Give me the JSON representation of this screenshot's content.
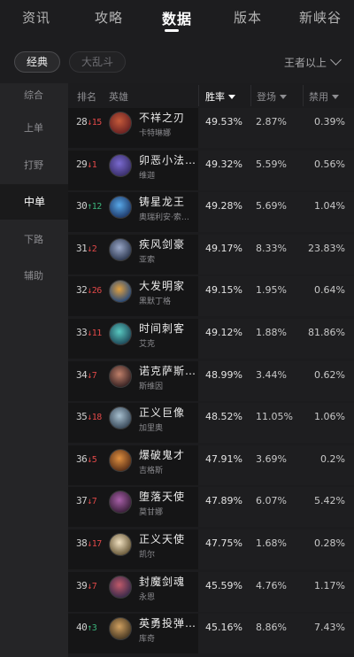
{
  "nav": {
    "tabs": [
      "资讯",
      "攻略",
      "数据",
      "版本",
      "新峡谷"
    ],
    "active_index": 2
  },
  "modes": {
    "classic": "经典",
    "aram": "大乱斗",
    "rank_filter": "王者以上"
  },
  "sidebar": {
    "items": [
      "综合",
      "上单",
      "打野",
      "中单",
      "下路",
      "辅助"
    ],
    "active_index": 3
  },
  "table": {
    "headers": {
      "rank": "排名",
      "hero": "英雄",
      "win": "胜率",
      "pick": "登场",
      "ban": "禁用"
    },
    "sorted_column": "win",
    "rows": [
      {
        "rank": "28",
        "change": "↓15",
        "dir": "down",
        "name": "不祥之刃",
        "sub": "卡特琳娜",
        "win": "49.53%",
        "pick": "2.87%",
        "ban": "0.39%",
        "avatar": [
          "#6a2222",
          "#c55a3a"
        ]
      },
      {
        "rank": "29",
        "change": "↓1",
        "dir": "down",
        "name": "卯恶小法…",
        "sub": "维迦",
        "win": "49.32%",
        "pick": "5.59%",
        "ban": "0.56%",
        "avatar": [
          "#3a2f6a",
          "#7a6ad0"
        ]
      },
      {
        "rank": "30",
        "change": "↑12",
        "dir": "up",
        "name": "铸星龙王",
        "sub": "奥瑞利安·索…",
        "win": "49.28%",
        "pick": "5.69%",
        "ban": "1.04%",
        "avatar": [
          "#1f3a6a",
          "#58a8e8"
        ]
      },
      {
        "rank": "31",
        "change": "↓2",
        "dir": "down",
        "name": "疾风剑豪",
        "sub": "亚索",
        "win": "49.17%",
        "pick": "8.33%",
        "ban": "23.83%",
        "avatar": [
          "#2f3a52",
          "#9aa8c8"
        ]
      },
      {
        "rank": "32",
        "change": "↓26",
        "dir": "down",
        "name": "大发明家",
        "sub": "黑默丁格",
        "win": "49.15%",
        "pick": "1.95%",
        "ban": "0.64%",
        "avatar": [
          "#284a7a",
          "#e0a040"
        ]
      },
      {
        "rank": "33",
        "change": "↓11",
        "dir": "down",
        "name": "时间刺客",
        "sub": "艾克",
        "win": "49.12%",
        "pick": "1.88%",
        "ban": "81.86%",
        "avatar": [
          "#1f4a5a",
          "#58c8c0"
        ]
      },
      {
        "rank": "34",
        "change": "↓7",
        "dir": "down",
        "name": "诺克萨斯…",
        "sub": "斯维因",
        "win": "48.99%",
        "pick": "3.44%",
        "ban": "0.62%",
        "avatar": [
          "#3a2424",
          "#c0806a"
        ]
      },
      {
        "rank": "35",
        "change": "↓18",
        "dir": "down",
        "name": "正义巨像",
        "sub": "加里奥",
        "win": "48.52%",
        "pick": "11.05%",
        "ban": "1.06%",
        "avatar": [
          "#3a4a5a",
          "#a8c0d0"
        ]
      },
      {
        "rank": "36",
        "change": "↓5",
        "dir": "down",
        "name": "爆破鬼才",
        "sub": "吉格斯",
        "win": "47.91%",
        "pick": "3.69%",
        "ban": "0.2%",
        "avatar": [
          "#5a3018",
          "#e09040"
        ]
      },
      {
        "rank": "37",
        "change": "↓7",
        "dir": "down",
        "name": "堕落天使",
        "sub": "莫甘娜",
        "win": "47.89%",
        "pick": "6.07%",
        "ban": "5.42%",
        "avatar": [
          "#3a1f3a",
          "#a860a8"
        ]
      },
      {
        "rank": "38",
        "change": "↓17",
        "dir": "down",
        "name": "正义天使",
        "sub": "凯尔",
        "win": "47.75%",
        "pick": "1.68%",
        "ban": "0.28%",
        "avatar": [
          "#6a5a3a",
          "#f0e0c0"
        ]
      },
      {
        "rank": "39",
        "change": "↓7",
        "dir": "down",
        "name": "封魔剑魂",
        "sub": "永恩",
        "win": "45.59%",
        "pick": "4.76%",
        "ban": "1.17%",
        "avatar": [
          "#3a2a4a",
          "#c05a6a"
        ]
      },
      {
        "rank": "40",
        "change": "↑3",
        "dir": "up",
        "name": "英勇投弹…",
        "sub": "库奇",
        "win": "45.16%",
        "pick": "8.86%",
        "ban": "7.43%",
        "avatar": [
          "#4a3a24",
          "#d0a060"
        ]
      }
    ]
  }
}
